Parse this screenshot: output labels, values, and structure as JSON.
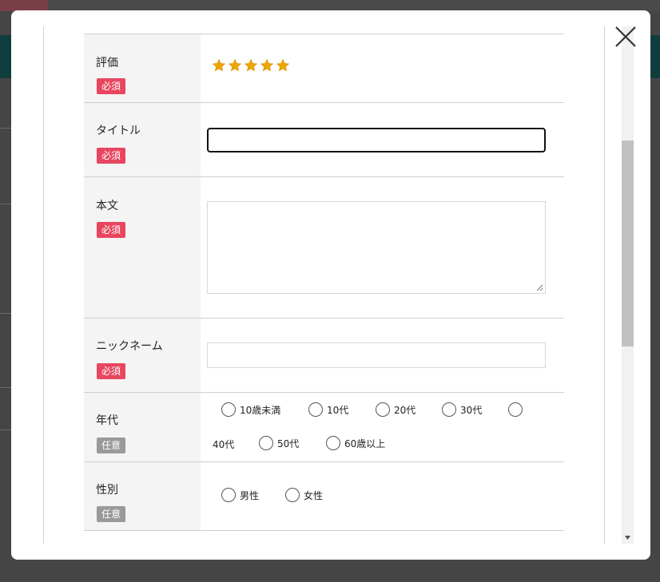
{
  "colors": {
    "required_badge": "#e8465f",
    "optional_badge": "#9a9a9a",
    "star": "#f0a500",
    "label_bg": "#f4f4f4"
  },
  "form": {
    "rating": {
      "label": "評価",
      "badge": "必須",
      "stars": 5
    },
    "title": {
      "label": "タイトル",
      "badge": "必須",
      "value": ""
    },
    "body": {
      "label": "本文",
      "badge": "必須",
      "value": ""
    },
    "nickname": {
      "label": "ニックネーム",
      "badge": "必須",
      "value": ""
    },
    "age": {
      "label": "年代",
      "badge": "任意",
      "options": [
        "10歳未満",
        "10代",
        "20代",
        "30代",
        "40代",
        "50代",
        "60歳以上"
      ]
    },
    "gender": {
      "label": "性別",
      "badge": "任意",
      "options": [
        "男性",
        "女性"
      ]
    }
  }
}
